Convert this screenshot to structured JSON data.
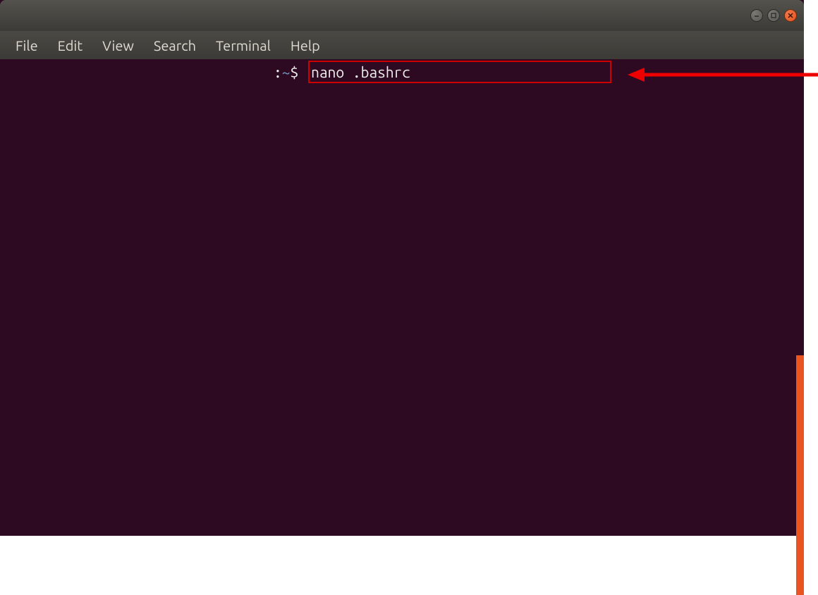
{
  "window": {
    "controls": {
      "minimize": "minimize",
      "maximize": "maximize",
      "close": "close"
    }
  },
  "menubar": {
    "items": [
      {
        "label": "File"
      },
      {
        "label": "Edit"
      },
      {
        "label": "View"
      },
      {
        "label": "Search"
      },
      {
        "label": "Terminal"
      },
      {
        "label": "Help"
      }
    ]
  },
  "terminal": {
    "prompt": {
      "prefix": ":",
      "path": "~",
      "suffix": "$ "
    },
    "command": "nano .bashrc"
  },
  "colors": {
    "terminal_bg": "#2d0a22",
    "terminal_fg": "#eeeeec",
    "path_color": "#729fcf",
    "highlight_border": "#cc0000",
    "accent": "#e95420",
    "arrow": "#ee0000"
  }
}
